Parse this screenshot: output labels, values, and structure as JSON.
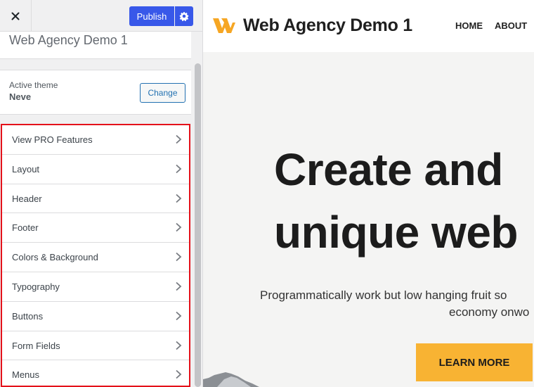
{
  "sidebar": {
    "close_label": "×",
    "publish_label": "Publish",
    "site_title": "Web Agency Demo 1",
    "active_theme_label": "Active theme",
    "active_theme_name": "Neve",
    "change_label": "Change",
    "panels": [
      {
        "label": "View PRO Features"
      },
      {
        "label": "Layout"
      },
      {
        "label": "Header"
      },
      {
        "label": "Footer"
      },
      {
        "label": "Colors & Background"
      },
      {
        "label": "Typography"
      },
      {
        "label": "Buttons"
      },
      {
        "label": "Form Fields"
      },
      {
        "label": "Menus"
      }
    ],
    "colors": {
      "publish": "#3858e9",
      "highlight_border": "#e4111a"
    }
  },
  "preview": {
    "site_name": "Web Agency Demo 1",
    "nav": [
      {
        "label": "HOME"
      },
      {
        "label": "ABOUT"
      }
    ],
    "hero_title_line1": "Create and",
    "hero_title_line2": "unique web",
    "hero_desc_line1": "Programmatically work but low hanging fruit so",
    "hero_desc_line2": "economy onwo",
    "cta_label": "LEARN MORE",
    "colors": {
      "accent": "#f8b333",
      "logo": "#f6a623"
    }
  }
}
